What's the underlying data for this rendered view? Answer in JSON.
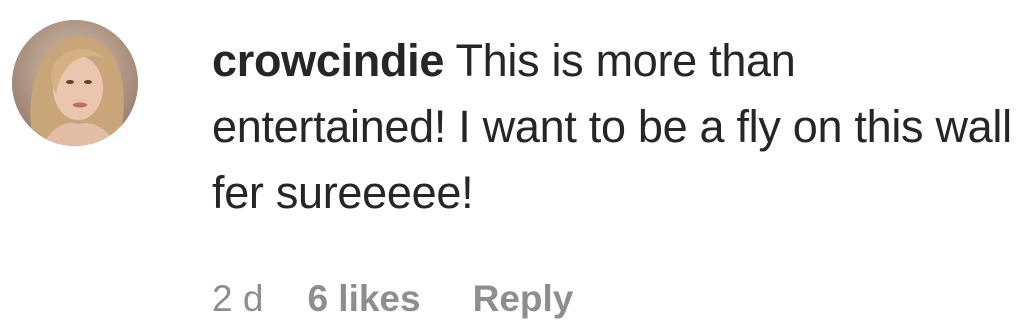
{
  "comment": {
    "username": "crowcindie",
    "text": "This is more than entertained! I want to be a fly on this wall fer sureeeee!",
    "time": "2 d",
    "likes": "6 likes",
    "reply_label": "Reply"
  },
  "colors": {
    "text": "#262626",
    "meta": "#8e8e8e",
    "background": "#ffffff"
  }
}
